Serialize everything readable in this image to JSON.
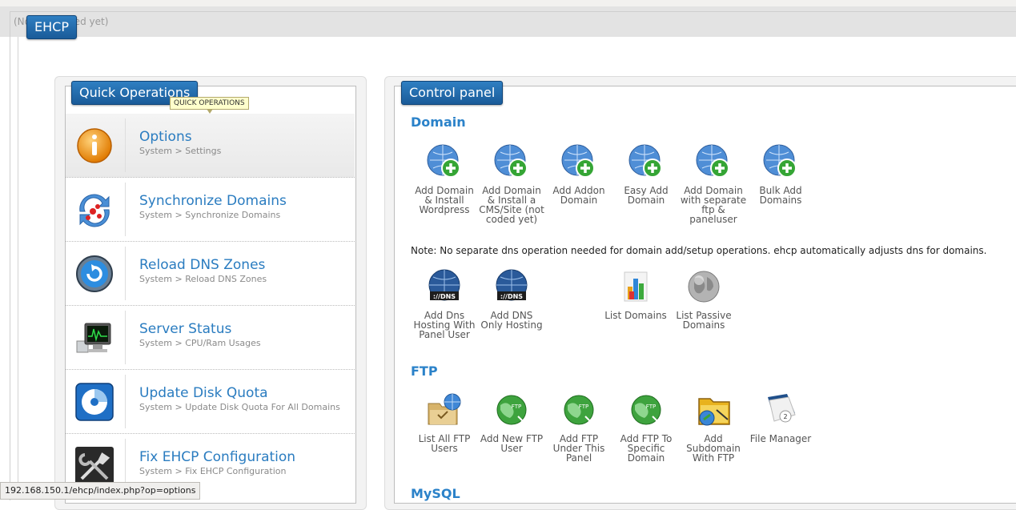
{
  "app": {
    "badge": "EHCP",
    "no_selection_text": "(No ... selected yet)"
  },
  "quick_ops": {
    "title": "Quick Operations",
    "tooltip": "QUICK OPERATIONS",
    "items": [
      {
        "title": "Options",
        "subtitle": "System > Settings",
        "icon": "info-icon"
      },
      {
        "title": "Synchronize Domains",
        "subtitle": "System > Synchronize Domains",
        "icon": "sync-icon"
      },
      {
        "title": "Reload DNS Zones",
        "subtitle": "System > Reload DNS Zones",
        "icon": "reload-icon"
      },
      {
        "title": "Server Status",
        "subtitle": "System > CPU/Ram Usages",
        "icon": "monitor-icon"
      },
      {
        "title": "Update Disk Quota",
        "subtitle": "System > Update Disk Quota For All Domains",
        "icon": "disk-icon"
      },
      {
        "title": "Fix EHCP Configuration",
        "subtitle": "System > Fix EHCP Configuration",
        "icon": "tools-icon"
      }
    ]
  },
  "control_panel": {
    "title": "Control panel",
    "domain": {
      "title": "Domain",
      "tiles": [
        "Add Domain & Install Wordpress",
        "Add Domain & Install a CMS/Site (not coded yet)",
        "Add Addon Domain",
        "Easy Add Domain",
        "Add Domain with separate ftp & paneluser",
        "Bulk Add Domains"
      ],
      "note": "Note: No separate dns operation needed for domain add/setup operations. ehcp automatically adjusts dns for domains.",
      "tiles2": [
        "Add Dns Hosting With Panel User",
        "Add DNS Only Hosting",
        "List Domains",
        "List Passive Domains"
      ],
      "dns_label": "://DNS"
    },
    "ftp": {
      "title": "FTP",
      "tiles": [
        "List All FTP Users",
        "Add New FTP User",
        "Add FTP Under This Panel",
        "Add FTP To Specific Domain",
        "Add Subdomain With FTP",
        "File Manager"
      ],
      "ftp_label": "FTP"
    },
    "mysql": {
      "title": "MySQL"
    }
  },
  "status_bar": {
    "url": "192.168.150.1/ehcp/index.php?op=options"
  },
  "colors": {
    "accent": "#2a7cc0",
    "badge_bg": "#1f6aa8",
    "tooltip_bg": "#ffffcc"
  }
}
